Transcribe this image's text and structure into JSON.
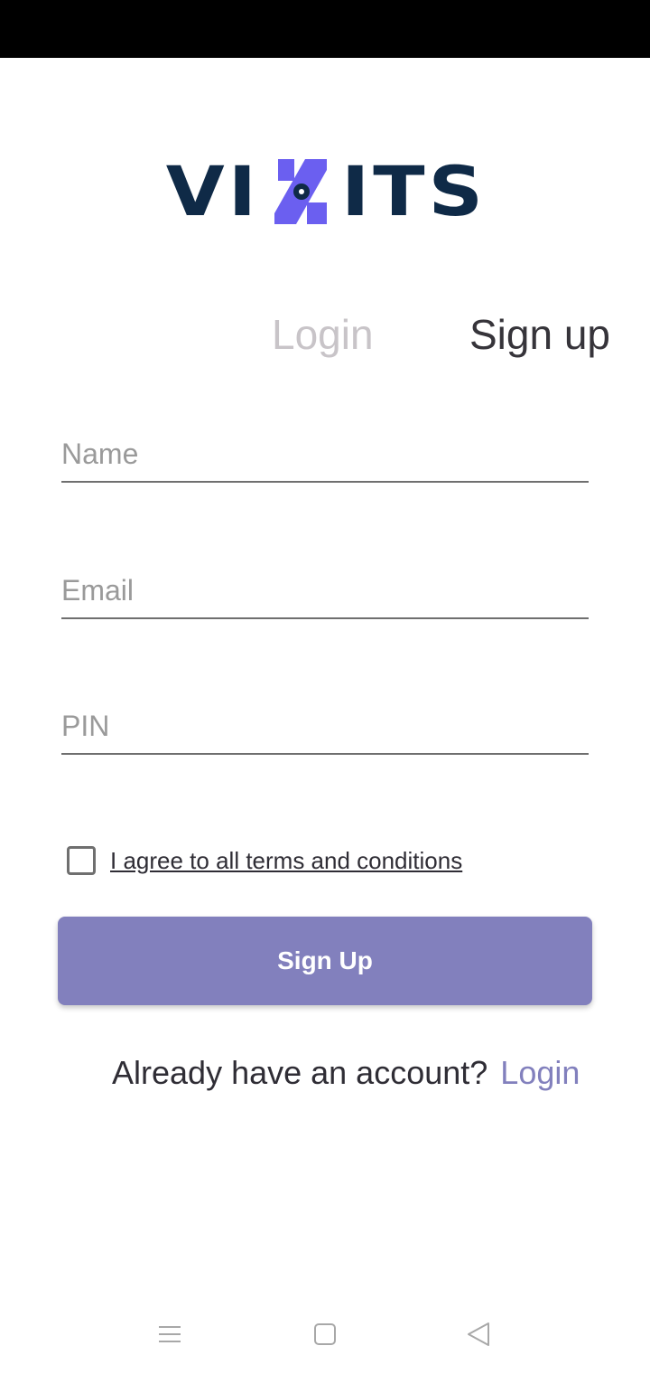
{
  "app": {
    "brand": "VIZITS",
    "brand_parts": {
      "left": "VI",
      "right": "ITS"
    },
    "colors": {
      "navy": "#0f2a47",
      "accent": "#6b5ff0",
      "button": "#8280bd",
      "link": "#8280bd"
    }
  },
  "tabs": {
    "login_label": "Login",
    "signup_label": "Sign up",
    "active": "signup"
  },
  "form": {
    "name_placeholder": "Name",
    "email_placeholder": "Email",
    "pin_placeholder": "PIN",
    "terms_label": "I agree to all terms and conditions",
    "terms_checked": false,
    "submit_label": "Sign Up"
  },
  "footer": {
    "prompt": "Already have an account?",
    "login_link": "Login"
  },
  "navbar": {
    "icons": [
      "menu-icon",
      "home-square-icon",
      "back-triangle-icon"
    ]
  }
}
